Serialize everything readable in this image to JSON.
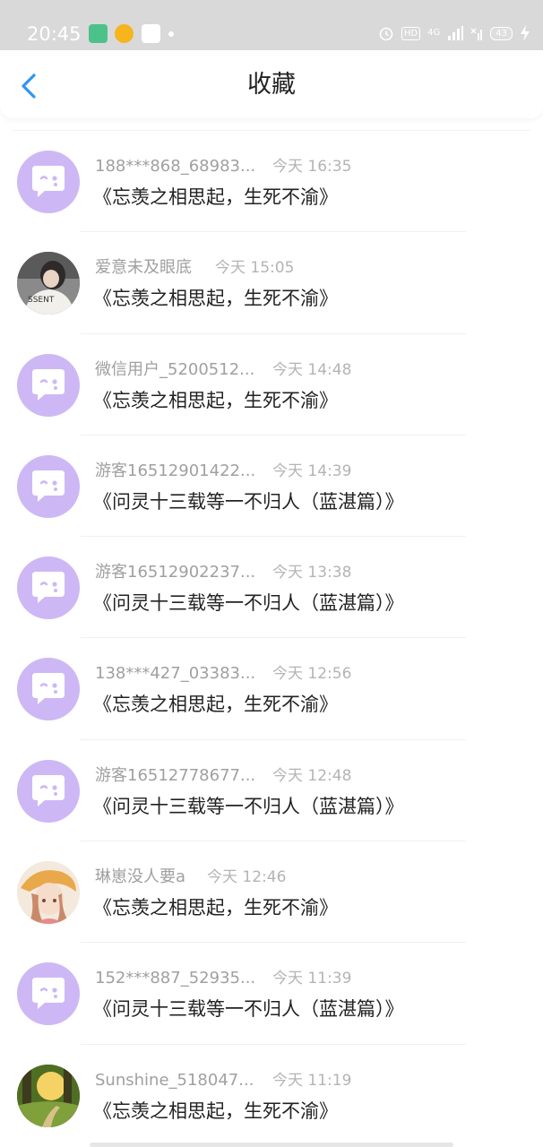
{
  "status_bar": {
    "time": "20:45",
    "hd_label": "HD",
    "network_label": "4G",
    "battery": "43"
  },
  "header": {
    "title": "收藏"
  },
  "items": [
    {
      "name": "188***868_68983...",
      "time": "今天 16:35",
      "title": "《忘羡之相思起，生死不渝》",
      "avatar": "default"
    },
    {
      "name": "爱意未及眼底",
      "time": "今天 15:05",
      "title": "《忘羡之相思起，生死不渝》",
      "avatar": "photo-shirt"
    },
    {
      "name": "微信用户_5200512...",
      "time": "今天 14:48",
      "title": "《忘羡之相思起，生死不渝》",
      "avatar": "default"
    },
    {
      "name": "游客16512901422...",
      "time": "今天 14:39",
      "title": "《问灵十三载等一不归人（蓝湛篇）》",
      "avatar": "default"
    },
    {
      "name": "游客16512902237...",
      "time": "今天 13:38",
      "title": "《问灵十三载等一不归人（蓝湛篇）》",
      "avatar": "default"
    },
    {
      "name": "138***427_03383...",
      "time": "今天 12:56",
      "title": "《忘羡之相思起，生死不渝》",
      "avatar": "default"
    },
    {
      "name": "游客16512778677...",
      "time": "今天 12:48",
      "title": "《问灵十三载等一不归人（蓝湛篇）》",
      "avatar": "default"
    },
    {
      "name": "琳崽没人要a",
      "time": "今天 12:46",
      "title": "《忘羡之相思起，生死不渝》",
      "avatar": "photo-anime"
    },
    {
      "name": "152***887_52935...",
      "time": "今天 11:39",
      "title": "《问灵十三载等一不归人（蓝湛篇）》",
      "avatar": "default"
    },
    {
      "name": "Sunshine_518047...",
      "time": "今天 11:19",
      "title": "《忘羡之相思起，生死不渝》",
      "avatar": "photo-forest"
    }
  ],
  "colors": {
    "accent": "#2f96f0",
    "avatar_default_bg": "#cdb8f5",
    "status_bar_bg": "#d9d9d9"
  },
  "icons": {
    "back": "chevron-left-icon",
    "default_avatar": "chat-bubble-icon"
  }
}
